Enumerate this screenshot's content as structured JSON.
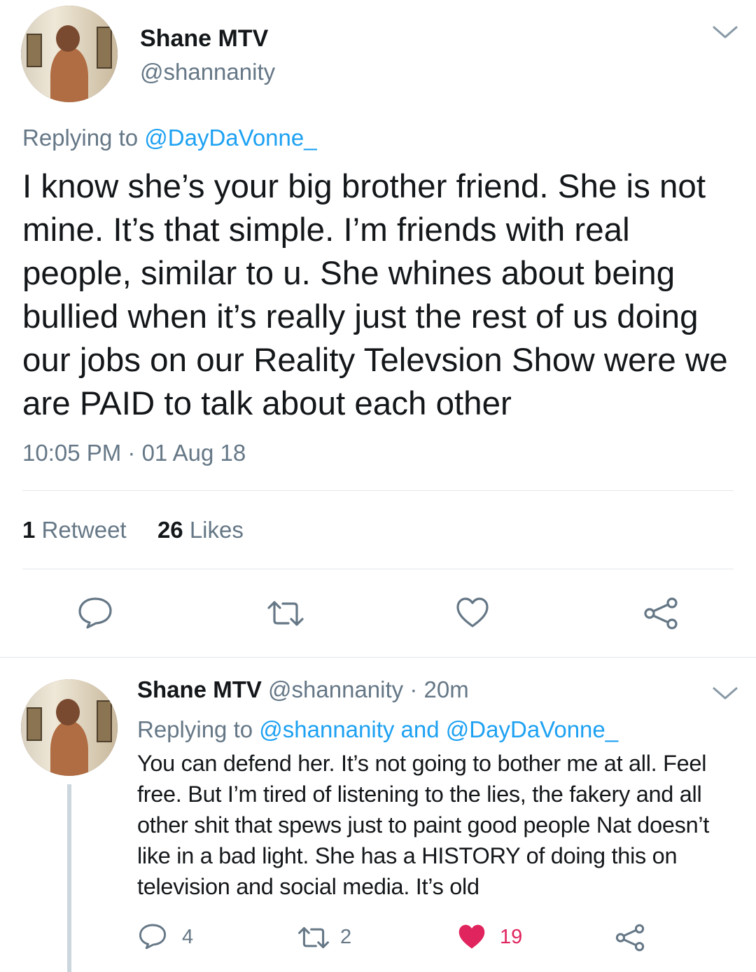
{
  "main_tweet": {
    "name": "Shane MTV",
    "handle": "@shannanity",
    "replying_prefix": "Replying to ",
    "replying_to": "@DayDaVonne_",
    "text": "I know she’s your big brother friend. She is not mine. It’s that simple. I’m friends with real people, similar to u. She whines about being bullied when it’s really just the rest of us doing our jobs on our Reality Televsion Show were we are PAID to talk about each other",
    "timestamp": "10:05 PM · 01 Aug 18",
    "retweet_count": "1",
    "retweet_label": "Retweet",
    "like_count": "26",
    "like_label": "Likes",
    "icons": [
      "reply-icon",
      "retweet-icon",
      "like-icon",
      "share-icon"
    ]
  },
  "reply_tweet": {
    "name": "Shane MTV",
    "handle": "@shannanity",
    "time": "· 20m",
    "replying_prefix": "Replying to ",
    "replying_to_1": "@shannanity",
    "replying_and": " and ",
    "replying_to_2": "@DayDaVonne_",
    "text": "You can defend her. It’s not going to bother me at all. Feel free. But I’m tired of listening to the lies, the fakery and all other shit that spews just to paint good people Nat doesn’t like in a bad light. She has a HISTORY of doing this on television and social media. It’s old",
    "reply_count": "4",
    "retweet_count": "2",
    "like_count": "19",
    "liked": true
  },
  "colors": {
    "text": "#14171a",
    "secondary": "#657786",
    "link": "#1da1f2",
    "like": "#e0245e",
    "divider": "#e1e8ed"
  }
}
